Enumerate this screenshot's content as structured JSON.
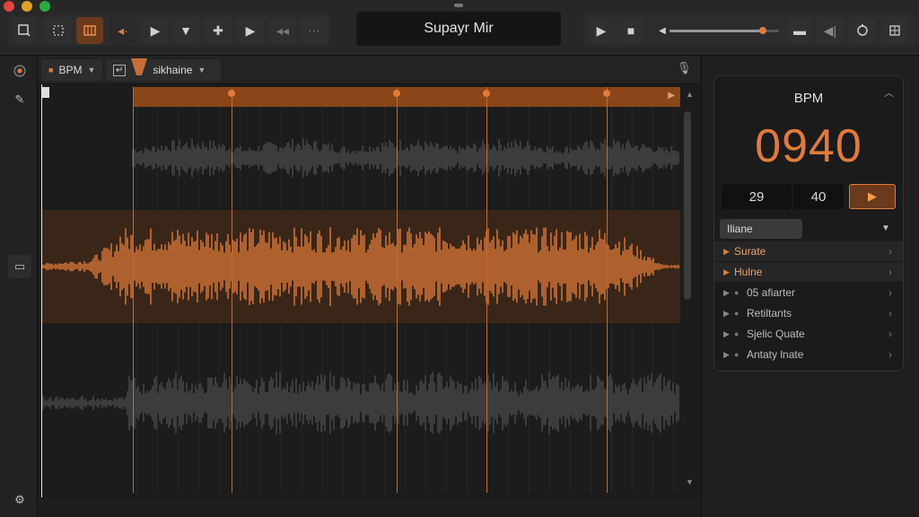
{
  "window": {
    "title": "Supayr Mir",
    "traffic_colors": [
      "#e0443e",
      "#dea123",
      "#2aac3f"
    ]
  },
  "toolbar": {
    "left_icons": [
      "select-icon",
      "crop-icon",
      "snap-icon",
      "cue-icon",
      "play-icon",
      "stamp-icon",
      "plus-icon",
      "forward-icon",
      "rewind-icon",
      "grid-icon"
    ],
    "right_icons": [
      "transport-play-icon",
      "stop-icon",
      "speaker-icon",
      "monitor-icon",
      "record-icon",
      "loop-icon",
      "settings-icon"
    ],
    "volume": 0.85
  },
  "subbar": {
    "bpm_label": "BPM",
    "track_name": "sikhaine"
  },
  "panel": {
    "title": "BPM",
    "bpm_value": "0940",
    "num_a": "29",
    "num_b": "40",
    "dropdown_label": "Iliane",
    "items": [
      {
        "label": "Surate",
        "highlight": true
      },
      {
        "label": "Hulne",
        "highlight": true
      },
      {
        "label": "05 afiarter",
        "highlight": false
      },
      {
        "label": "Retiltants",
        "highlight": false
      },
      {
        "label": "Sjelic Quate",
        "highlight": false
      },
      {
        "label": "Antaty lnate",
        "highlight": false
      }
    ]
  },
  "colors": {
    "accent": "#e07b39",
    "waveform_gray": "#4a4a4a",
    "waveform_orange": "#e07b39"
  }
}
